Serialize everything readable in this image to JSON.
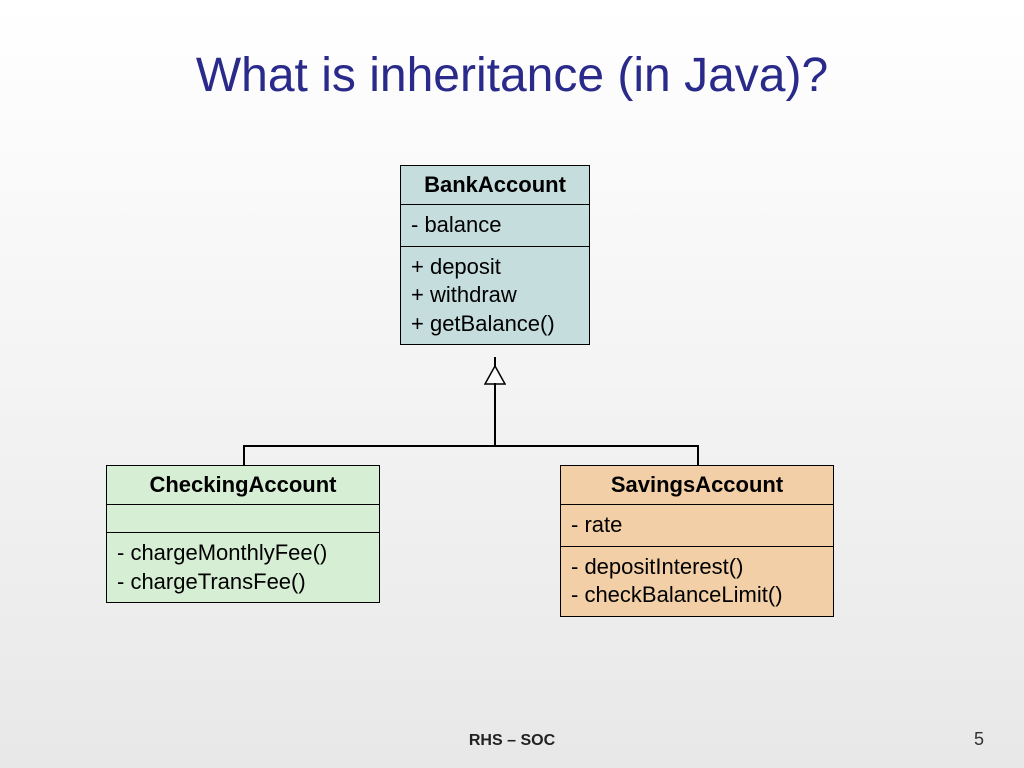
{
  "title": "What is inheritance (in Java)?",
  "classes": {
    "bank": {
      "name": "BankAccount",
      "attrs": "- balance",
      "ops": "+ deposit\n+ withdraw\n+ getBalance()"
    },
    "checking": {
      "name": "CheckingAccount",
      "attrs": "",
      "ops": "- chargeMonthlyFee()\n- chargeTransFee()"
    },
    "savings": {
      "name": "SavingsAccount",
      "attrs": "- rate",
      "ops": "- depositInterest()\n- checkBalanceLimit()"
    }
  },
  "footer": "RHS – SOC",
  "page": "5"
}
